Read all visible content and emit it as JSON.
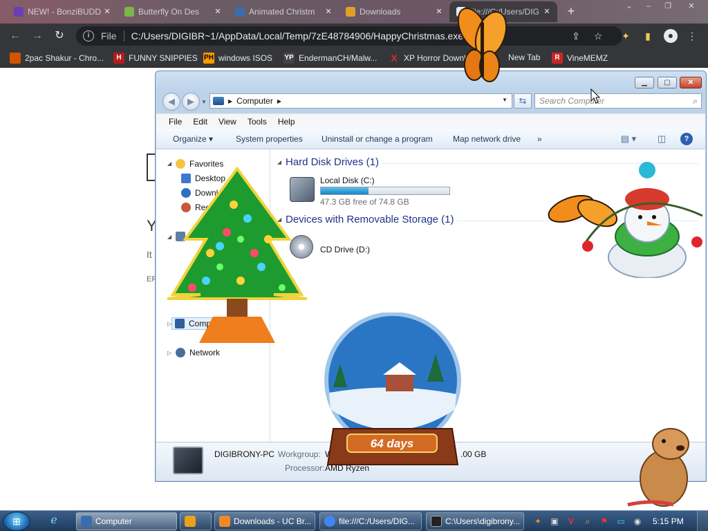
{
  "chrome": {
    "tabs": [
      {
        "label": "NEW! - BonziBUDD",
        "favicon_color": "#6a3fb5"
      },
      {
        "label": "Butterfly On Des",
        "favicon_color": "#7ab648"
      },
      {
        "label": "Animated Christm",
        "favicon_color": "#3a6db0"
      },
      {
        "label": "Downloads",
        "favicon_color": "#e0a028"
      },
      {
        "label": "file:///C:/Users/DIG",
        "favicon_color": "#e8eaed"
      }
    ],
    "address": {
      "scheme_label": "File",
      "url": "C:/Users/DIGIBR~1/AppData/Local/Temp/7zE48784906/HappyChristmas.exe"
    },
    "bookmarks": [
      {
        "label": "2pac Shakur - Chro...",
        "icon": "",
        "color": "#d35400"
      },
      {
        "label": "FUNNY SNIPPIES",
        "icon": "H",
        "color": "#b71c1c"
      },
      {
        "label": "windows ISOS",
        "icon": "PH",
        "color": "#ff9800"
      },
      {
        "label": "EndermanCH/Malw...",
        "icon": "YP",
        "color": "#444444"
      },
      {
        "label": "XP Horror Downlo...",
        "icon": "X",
        "color": "#d32f2f"
      },
      {
        "label": "New Tab",
        "icon": "",
        "color": "#e8eaed"
      },
      {
        "label": "VineMEMZ",
        "icon": "R",
        "color": "#c62828"
      }
    ]
  },
  "page_fragments": {
    "y": "Y",
    "it": "It",
    "er": "ER"
  },
  "explorer": {
    "breadcrumb": "Computer",
    "search_placeholder": "Search Computer",
    "menu": [
      "File",
      "Edit",
      "View",
      "Tools",
      "Help"
    ],
    "commands": {
      "organize": "Organize",
      "system_properties": "System properties",
      "uninstall": "Uninstall or change a program",
      "map_drive": "Map network drive",
      "more": "»"
    },
    "nav": {
      "favorites": "Favorites",
      "desktop": "Desktop",
      "downloads": "Downlo",
      "recent": "Recen",
      "libraries": "Lib",
      "computer": "Computer",
      "network": "Network"
    },
    "groups": {
      "hdd": "Hard Disk Drives (1)",
      "removable": "Devices with Removable Storage (1)"
    },
    "local_disk": {
      "name": "Local Disk (C:)",
      "free_text": "47.3 GB free of 74.8 GB",
      "used_fraction": 0.37
    },
    "cd_drive": {
      "name": "CD Drive (D:)"
    },
    "details": {
      "pc_name": "DIGIBRONY-PC",
      "workgroup_label": "Workgroup:",
      "workgroup_value": "W",
      "memory_value": ".00 GB",
      "processor_label": "Processor:",
      "processor_value": "AMD Ryzen"
    }
  },
  "decorations": {
    "globe_label": "64 days"
  },
  "taskbar": {
    "buttons": [
      {
        "label": "Computer",
        "color": "#3a6db0"
      },
      {
        "label": "",
        "color": "#e8a31a"
      },
      {
        "label": "Downloads - UC Br...",
        "color": "#f08a24"
      },
      {
        "label": "file:///C:/Users/DIG...",
        "color": "#4285f4"
      },
      {
        "label": "C:\\Users\\digibrony...",
        "color": "#222222"
      }
    ],
    "clock": "5:15 PM"
  }
}
